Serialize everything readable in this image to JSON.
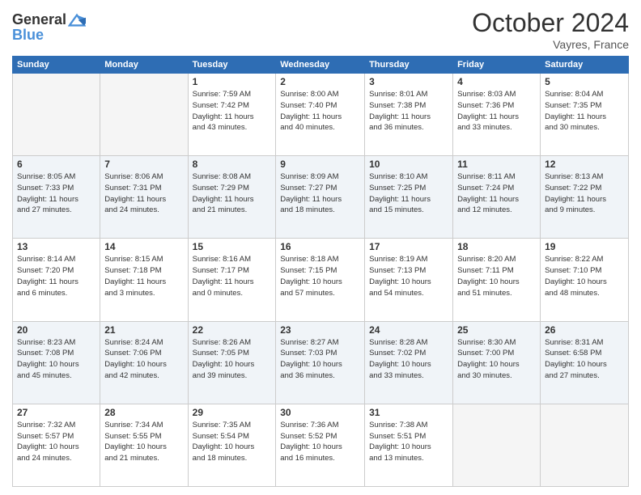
{
  "header": {
    "logo_line1": "General",
    "logo_line2": "Blue",
    "month": "October 2024",
    "location": "Vayres, France"
  },
  "days_of_week": [
    "Sunday",
    "Monday",
    "Tuesday",
    "Wednesday",
    "Thursday",
    "Friday",
    "Saturday"
  ],
  "weeks": [
    [
      {
        "num": "",
        "info": ""
      },
      {
        "num": "",
        "info": ""
      },
      {
        "num": "1",
        "info": "Sunrise: 7:59 AM\nSunset: 7:42 PM\nDaylight: 11 hours\nand 43 minutes."
      },
      {
        "num": "2",
        "info": "Sunrise: 8:00 AM\nSunset: 7:40 PM\nDaylight: 11 hours\nand 40 minutes."
      },
      {
        "num": "3",
        "info": "Sunrise: 8:01 AM\nSunset: 7:38 PM\nDaylight: 11 hours\nand 36 minutes."
      },
      {
        "num": "4",
        "info": "Sunrise: 8:03 AM\nSunset: 7:36 PM\nDaylight: 11 hours\nand 33 minutes."
      },
      {
        "num": "5",
        "info": "Sunrise: 8:04 AM\nSunset: 7:35 PM\nDaylight: 11 hours\nand 30 minutes."
      }
    ],
    [
      {
        "num": "6",
        "info": "Sunrise: 8:05 AM\nSunset: 7:33 PM\nDaylight: 11 hours\nand 27 minutes."
      },
      {
        "num": "7",
        "info": "Sunrise: 8:06 AM\nSunset: 7:31 PM\nDaylight: 11 hours\nand 24 minutes."
      },
      {
        "num": "8",
        "info": "Sunrise: 8:08 AM\nSunset: 7:29 PM\nDaylight: 11 hours\nand 21 minutes."
      },
      {
        "num": "9",
        "info": "Sunrise: 8:09 AM\nSunset: 7:27 PM\nDaylight: 11 hours\nand 18 minutes."
      },
      {
        "num": "10",
        "info": "Sunrise: 8:10 AM\nSunset: 7:25 PM\nDaylight: 11 hours\nand 15 minutes."
      },
      {
        "num": "11",
        "info": "Sunrise: 8:11 AM\nSunset: 7:24 PM\nDaylight: 11 hours\nand 12 minutes."
      },
      {
        "num": "12",
        "info": "Sunrise: 8:13 AM\nSunset: 7:22 PM\nDaylight: 11 hours\nand 9 minutes."
      }
    ],
    [
      {
        "num": "13",
        "info": "Sunrise: 8:14 AM\nSunset: 7:20 PM\nDaylight: 11 hours\nand 6 minutes."
      },
      {
        "num": "14",
        "info": "Sunrise: 8:15 AM\nSunset: 7:18 PM\nDaylight: 11 hours\nand 3 minutes."
      },
      {
        "num": "15",
        "info": "Sunrise: 8:16 AM\nSunset: 7:17 PM\nDaylight: 11 hours\nand 0 minutes."
      },
      {
        "num": "16",
        "info": "Sunrise: 8:18 AM\nSunset: 7:15 PM\nDaylight: 10 hours\nand 57 minutes."
      },
      {
        "num": "17",
        "info": "Sunrise: 8:19 AM\nSunset: 7:13 PM\nDaylight: 10 hours\nand 54 minutes."
      },
      {
        "num": "18",
        "info": "Sunrise: 8:20 AM\nSunset: 7:11 PM\nDaylight: 10 hours\nand 51 minutes."
      },
      {
        "num": "19",
        "info": "Sunrise: 8:22 AM\nSunset: 7:10 PM\nDaylight: 10 hours\nand 48 minutes."
      }
    ],
    [
      {
        "num": "20",
        "info": "Sunrise: 8:23 AM\nSunset: 7:08 PM\nDaylight: 10 hours\nand 45 minutes."
      },
      {
        "num": "21",
        "info": "Sunrise: 8:24 AM\nSunset: 7:06 PM\nDaylight: 10 hours\nand 42 minutes."
      },
      {
        "num": "22",
        "info": "Sunrise: 8:26 AM\nSunset: 7:05 PM\nDaylight: 10 hours\nand 39 minutes."
      },
      {
        "num": "23",
        "info": "Sunrise: 8:27 AM\nSunset: 7:03 PM\nDaylight: 10 hours\nand 36 minutes."
      },
      {
        "num": "24",
        "info": "Sunrise: 8:28 AM\nSunset: 7:02 PM\nDaylight: 10 hours\nand 33 minutes."
      },
      {
        "num": "25",
        "info": "Sunrise: 8:30 AM\nSunset: 7:00 PM\nDaylight: 10 hours\nand 30 minutes."
      },
      {
        "num": "26",
        "info": "Sunrise: 8:31 AM\nSunset: 6:58 PM\nDaylight: 10 hours\nand 27 minutes."
      }
    ],
    [
      {
        "num": "27",
        "info": "Sunrise: 7:32 AM\nSunset: 5:57 PM\nDaylight: 10 hours\nand 24 minutes."
      },
      {
        "num": "28",
        "info": "Sunrise: 7:34 AM\nSunset: 5:55 PM\nDaylight: 10 hours\nand 21 minutes."
      },
      {
        "num": "29",
        "info": "Sunrise: 7:35 AM\nSunset: 5:54 PM\nDaylight: 10 hours\nand 18 minutes."
      },
      {
        "num": "30",
        "info": "Sunrise: 7:36 AM\nSunset: 5:52 PM\nDaylight: 10 hours\nand 16 minutes."
      },
      {
        "num": "31",
        "info": "Sunrise: 7:38 AM\nSunset: 5:51 PM\nDaylight: 10 hours\nand 13 minutes."
      },
      {
        "num": "",
        "info": ""
      },
      {
        "num": "",
        "info": ""
      }
    ]
  ]
}
